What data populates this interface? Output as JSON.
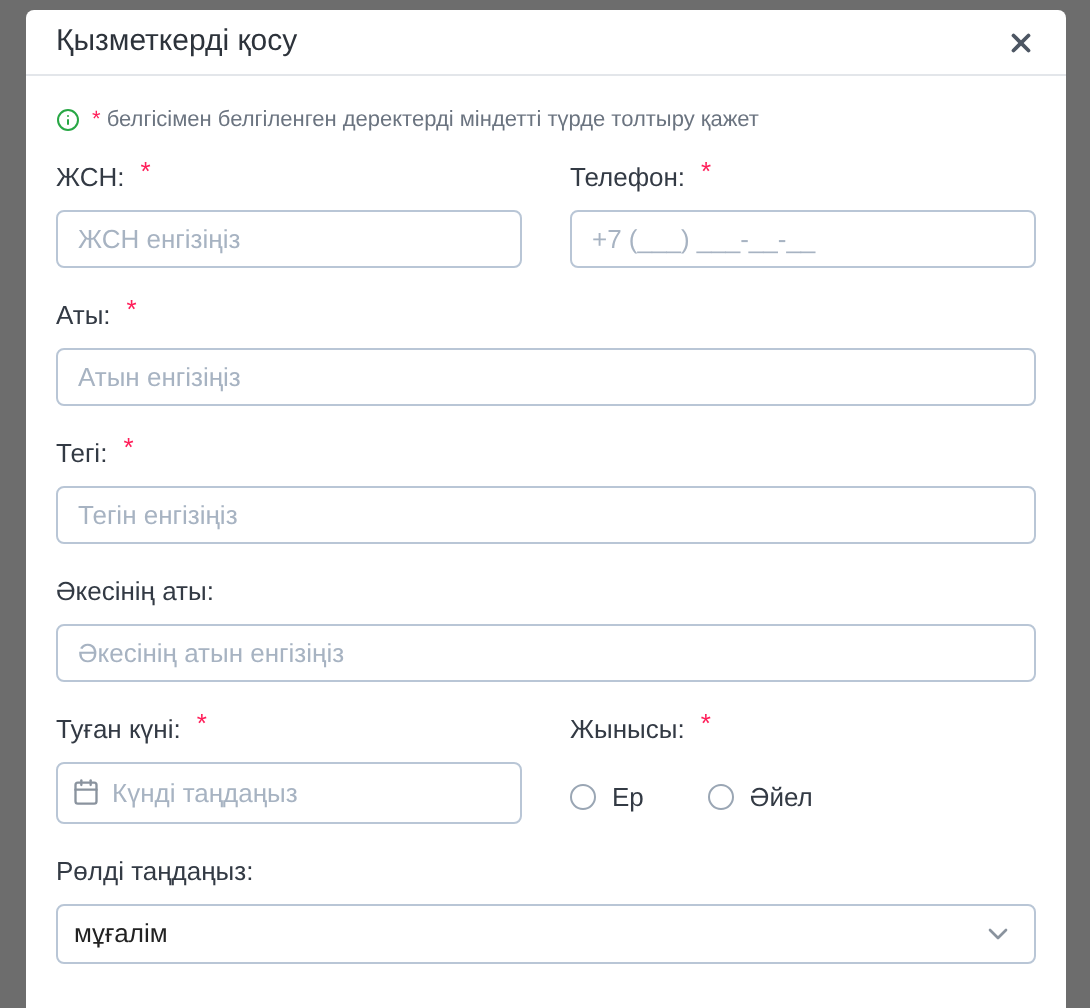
{
  "dialog": {
    "title": "Қызметкерді қосу",
    "note": {
      "mark": "*",
      "text": "белгісімен белгіленген деректерді міндетті түрде толтыру қажет"
    },
    "rows": [
      [
        {
          "kind": "text",
          "label": "ЖСН:",
          "required": true,
          "placeholder": "ЖСН енгізіңіз"
        },
        {
          "kind": "text",
          "label": "Телефон:",
          "required": true,
          "placeholder": "+7 (___) ___-__-__"
        }
      ],
      [
        {
          "kind": "text",
          "label": "Аты:",
          "required": true,
          "placeholder": "Атын енгізіңіз"
        }
      ],
      [
        {
          "kind": "text",
          "label": "Тегі:",
          "required": true,
          "placeholder": "Тегін енгізіңіз"
        }
      ],
      [
        {
          "kind": "text",
          "label": "Әкесінің аты:",
          "required": false,
          "placeholder": "Әкесінің атын енгізіңіз"
        }
      ],
      [
        {
          "kind": "date",
          "label": "Туған күні:",
          "required": true,
          "placeholder": "Күнді таңдаңыз"
        },
        {
          "kind": "radio",
          "label": "Жынысы:",
          "required": true,
          "options": [
            {
              "label": "Ер",
              "selected": false
            },
            {
              "label": "Әйел",
              "selected": false
            }
          ]
        }
      ],
      [
        {
          "kind": "select",
          "label": "Рөлді таңдаңыз:",
          "required": false,
          "value": "мұғалім"
        }
      ]
    ]
  }
}
